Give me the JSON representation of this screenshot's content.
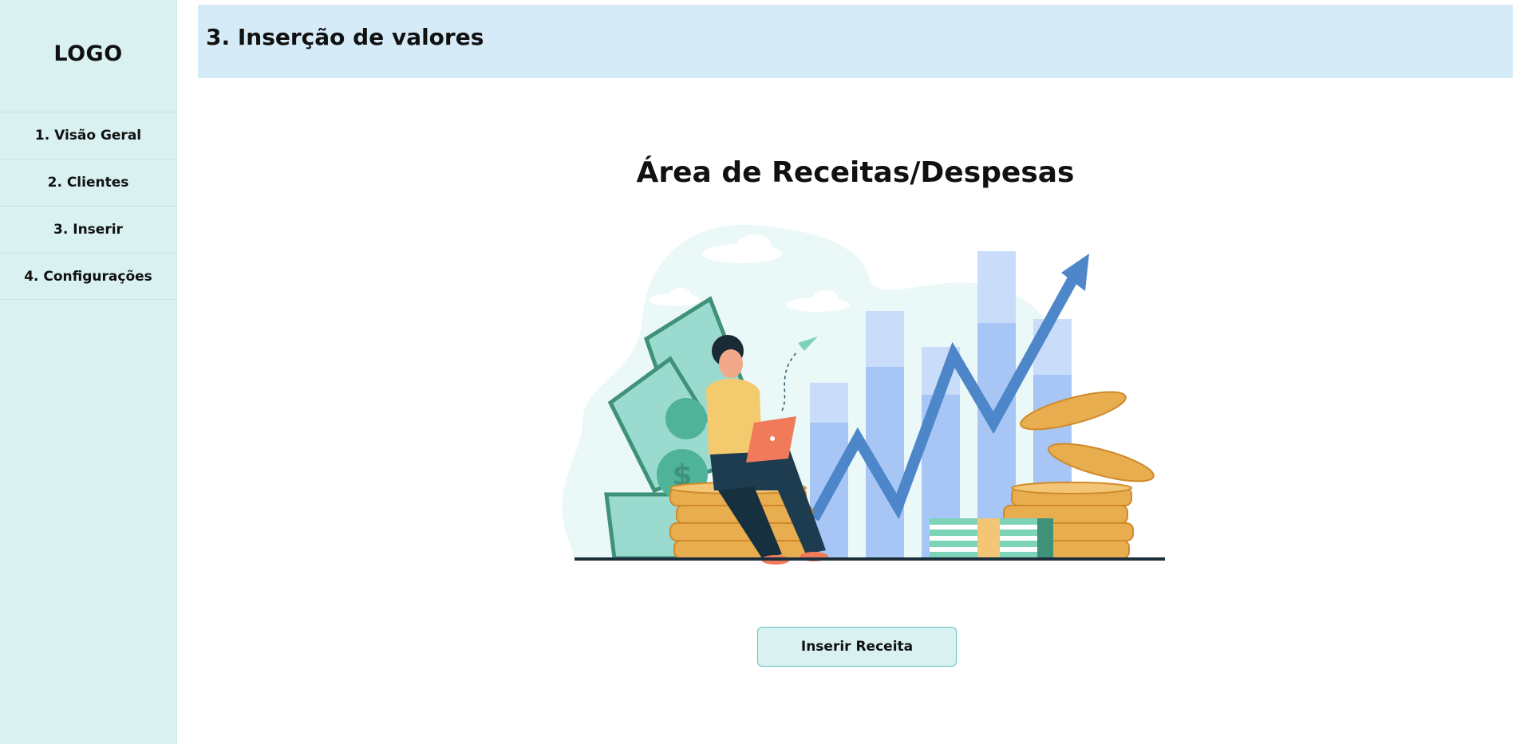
{
  "sidebar": {
    "logo": "LOGO",
    "items": [
      {
        "label": "1. Visão Geral"
      },
      {
        "label": "2. Clientes"
      },
      {
        "label": "3. Inserir"
      },
      {
        "label": "4. Configurações"
      }
    ]
  },
  "header": {
    "title": "3. Inserção de valores"
  },
  "main": {
    "title": "Área de Receitas/Despesas",
    "illustration_icon": "finance-growth-illustration",
    "button_label": "Inserir Receita"
  },
  "colors": {
    "sidebar_bg": "#d9f1f1",
    "header_bg": "#d6ebf8",
    "button_border": "#5fc0c4"
  }
}
